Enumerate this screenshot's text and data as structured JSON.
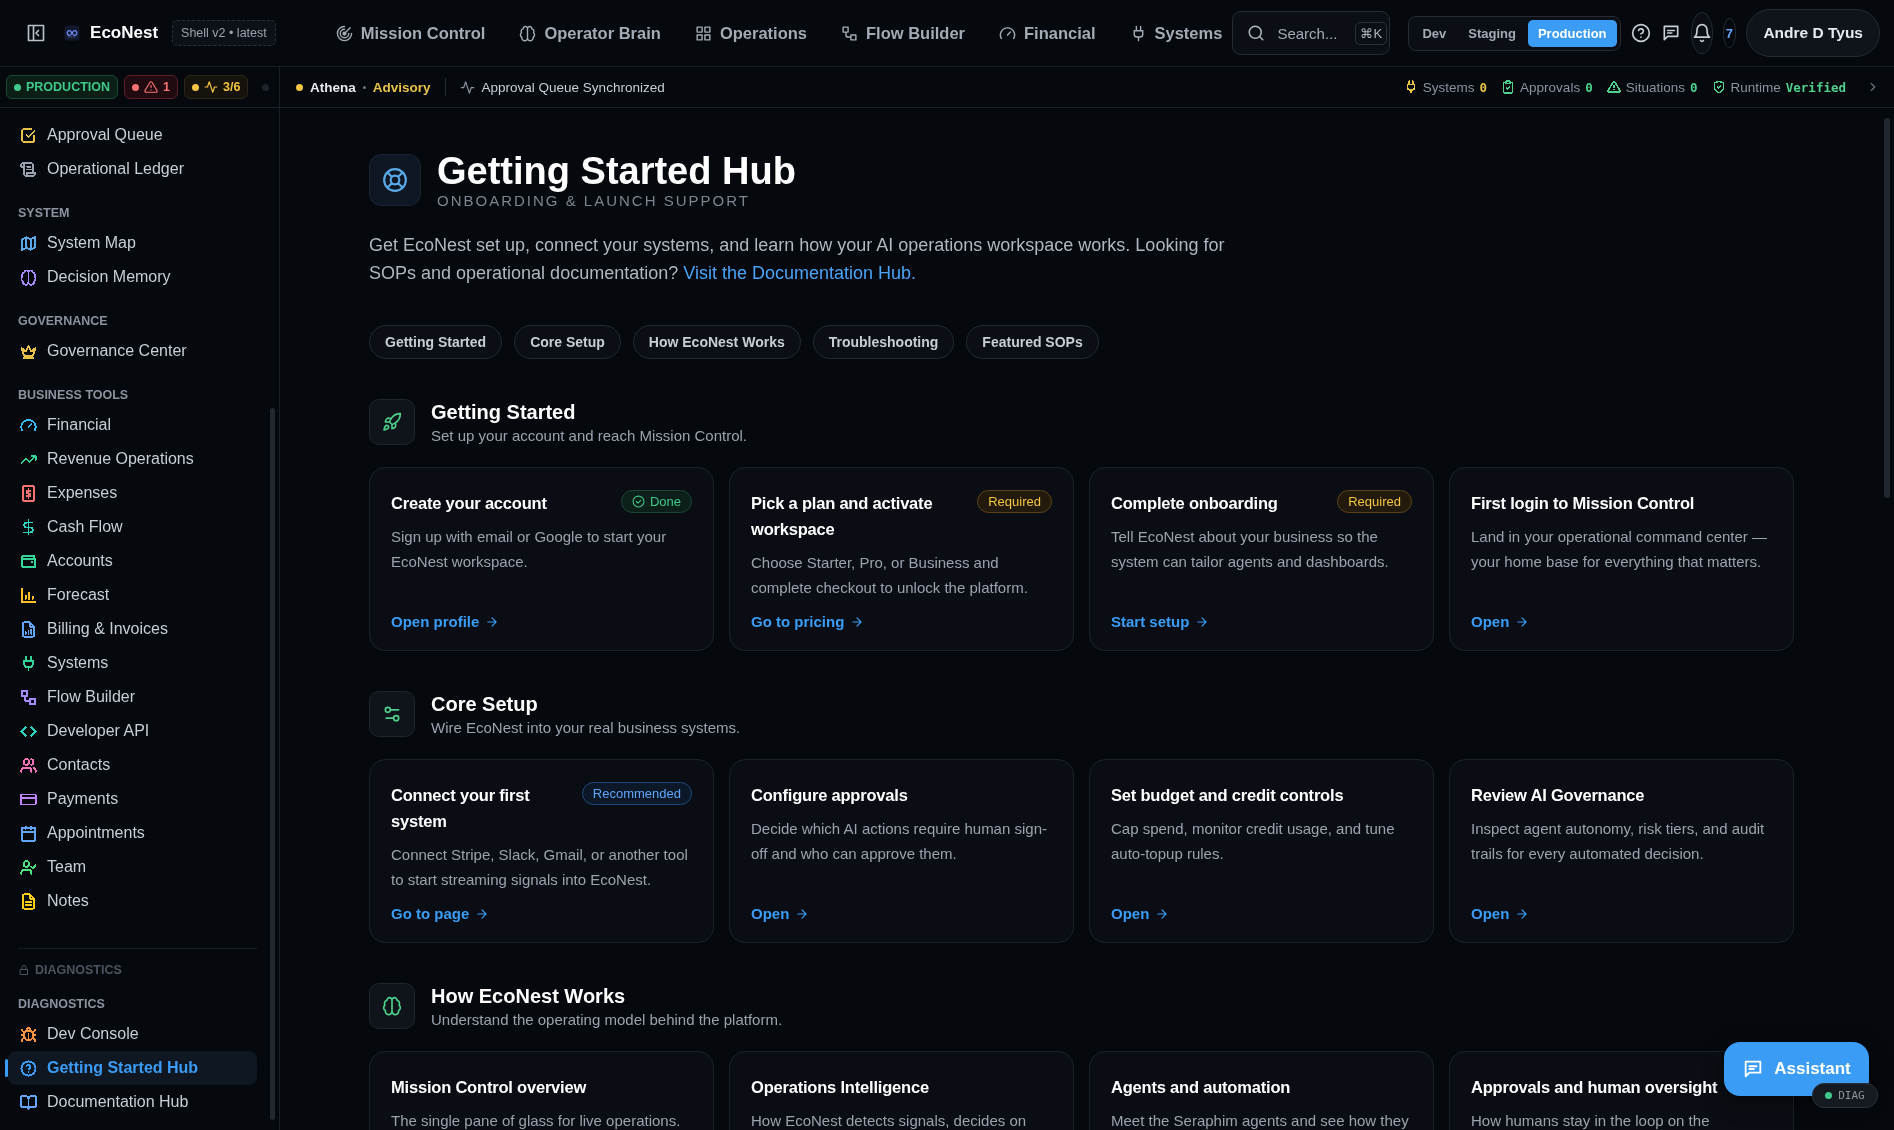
{
  "topbar": {
    "brand": "EcoNest",
    "version": "Shell v2 • latest",
    "nav": [
      {
        "label": "Mission Control",
        "selected": false
      },
      {
        "label": "Operator Brain",
        "selected": false
      },
      {
        "label": "Operations",
        "selected": false
      },
      {
        "label": "Flow Builder",
        "selected": false
      },
      {
        "label": "Financial",
        "selected": false
      },
      {
        "label": "Systems",
        "selected": false
      }
    ],
    "search": {
      "placeholder": "Search...",
      "shortcut": "⌘K"
    },
    "environments": [
      {
        "label": "Dev",
        "selected": false
      },
      {
        "label": "Staging",
        "selected": false
      },
      {
        "label": "Production",
        "selected": true
      }
    ],
    "notifications": "7",
    "user": "Andre D Tyus"
  },
  "statusbar": {
    "environment": "PRODUCTION",
    "alerts": "1",
    "health": "3/6",
    "agent": "Athena",
    "mode": "Advisory",
    "event": "Approval Queue Synchronized",
    "metrics": [
      {
        "label": "Systems",
        "value": "0",
        "color": "#e8c14a"
      },
      {
        "label": "Approvals",
        "value": "0",
        "color": "#4ed08a"
      },
      {
        "label": "Situations",
        "value": "0",
        "color": "#4ed08a"
      },
      {
        "label": "Runtime",
        "value": "Verified",
        "color": "#4ed08a"
      }
    ]
  },
  "sidebar": {
    "groups": [
      {
        "items": [
          {
            "label": "Approval Queue",
            "color": "#e8c14a",
            "selected": false
          },
          {
            "label": "Operational Ledger",
            "color": "#9aa3ad",
            "selected": false
          }
        ]
      },
      {
        "heading": "SYSTEM",
        "locked": false,
        "items": [
          {
            "label": "System Map",
            "color": "#5aa9e6",
            "selected": false
          },
          {
            "label": "Decision Memory",
            "color": "#a78bfa",
            "selected": false
          }
        ]
      },
      {
        "heading": "GOVERNANCE",
        "locked": false,
        "items": [
          {
            "label": "Governance Center",
            "color": "#e8c14a",
            "selected": false
          }
        ]
      },
      {
        "heading": "BUSINESS TOOLS",
        "locked": false,
        "items": [
          {
            "label": "Financial",
            "color": "#38bdf8",
            "selected": false
          },
          {
            "label": "Revenue Operations",
            "color": "#34d399",
            "selected": false
          },
          {
            "label": "Expenses",
            "color": "#f87171",
            "selected": false
          },
          {
            "label": "Cash Flow",
            "color": "#2dd4bf",
            "selected": false
          },
          {
            "label": "Accounts",
            "color": "#34d399",
            "selected": false
          },
          {
            "label": "Forecast",
            "color": "#fbbf24",
            "selected": false
          },
          {
            "label": "Billing & Invoices",
            "color": "#60a5fa",
            "selected": false
          },
          {
            "label": "Systems",
            "color": "#34d399",
            "selected": false
          },
          {
            "label": "Flow Builder",
            "color": "#a78bfa",
            "selected": false
          },
          {
            "label": "Developer API",
            "color": "#2dd4bf",
            "selected": false
          },
          {
            "label": "Contacts",
            "color": "#f472b6",
            "selected": false
          },
          {
            "label": "Payments",
            "color": "#c084fc",
            "selected": false
          },
          {
            "label": "Appointments",
            "color": "#60a5fa",
            "selected": false
          },
          {
            "label": "Team",
            "color": "#4ade80",
            "selected": false
          },
          {
            "label": "Notes",
            "color": "#facc15",
            "selected": false
          }
        ]
      },
      {
        "heading": "DIAGNOSTICS",
        "locked": true
      },
      {
        "heading": "DIAGNOSTICS",
        "locked": false,
        "items": [
          {
            "label": "Dev Console",
            "color": "#fb923c",
            "selected": false
          },
          {
            "label": "Getting Started Hub",
            "color": "#3b9cf5",
            "selected": true
          },
          {
            "label": "Documentation Hub",
            "color": "#60a5fa",
            "selected": false
          }
        ]
      }
    ]
  },
  "page": {
    "title": "Getting Started Hub",
    "subtitle": "ONBOARDING & LAUNCH SUPPORT",
    "intro": "Get EcoNest set up, connect your systems, and learn how your AI operations workspace works. Looking for SOPs and operational documentation?",
    "intro_link": "Visit the Documentation Hub.",
    "jump_links": [
      "Getting Started",
      "Core Setup",
      "How EcoNest Works",
      "Troubleshooting",
      "Featured SOPs"
    ],
    "sections": [
      {
        "title": "Getting Started",
        "subtitle": "Set up your account and reach Mission Control.",
        "cards": [
          {
            "title": "Create your account",
            "badge": {
              "text": "Done",
              "kind": "done"
            },
            "description": "Sign up with email or Google to start your EcoNest workspace.",
            "action": "Open profile"
          },
          {
            "title": "Pick a plan and activate workspace",
            "badge": {
              "text": "Required",
              "kind": "required"
            },
            "description": "Choose Starter, Pro, or Business and complete checkout to unlock the platform.",
            "action": "Go to pricing"
          },
          {
            "title": "Complete onboarding",
            "badge": {
              "text": "Required",
              "kind": "required"
            },
            "description": "Tell EcoNest about your business so the system can tailor agents and dashboards.",
            "action": "Start setup"
          },
          {
            "title": "First login to Mission Control",
            "description": "Land in your operational command center — your home base for everything that matters.",
            "action": "Open"
          }
        ]
      },
      {
        "title": "Core Setup",
        "subtitle": "Wire EcoNest into your real business systems.",
        "cards": [
          {
            "title": "Connect your first system",
            "badge": {
              "text": "Recommended",
              "kind": "recommended"
            },
            "description": "Connect Stripe, Slack, Gmail, or another tool to start streaming signals into EcoNest.",
            "action": "Go to page"
          },
          {
            "title": "Configure approvals",
            "description": "Decide which AI actions require human sign-off and who can approve them.",
            "action": "Open"
          },
          {
            "title": "Set budget and credit controls",
            "description": "Cap spend, monitor credit usage, and tune auto-topup rules.",
            "action": "Open"
          },
          {
            "title": "Review AI Governance",
            "description": "Inspect agent autonomy, risk tiers, and audit trails for every automated decision.",
            "action": "Open"
          }
        ]
      },
      {
        "title": "How EcoNest Works",
        "subtitle": "Understand the operating model behind the platform.",
        "cards": [
          {
            "title": "Mission Control overview",
            "description": "The single pane of glass for live operations."
          },
          {
            "title": "Operations Intelligence",
            "description": "How EcoNest detects signals, decides on"
          },
          {
            "title": "Agents and automation",
            "description": "Meet the Seraphim agents and see how they"
          },
          {
            "title": "Approvals and human oversight",
            "description": "How humans stay in the loop on the"
          }
        ]
      }
    ]
  },
  "assistant": "Assistant",
  "diag": "DIAG"
}
